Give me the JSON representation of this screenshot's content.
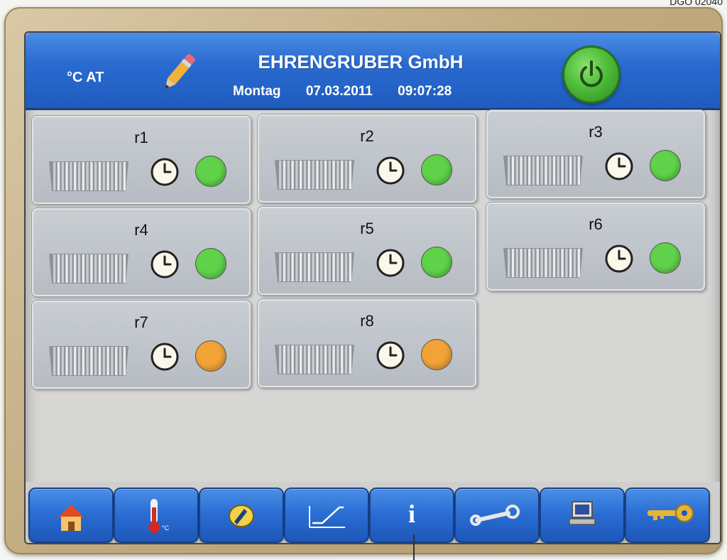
{
  "corner_label": "DGO 02040",
  "header": {
    "unit_label": "°C AT",
    "title": "EHRENGRUBER GmbH",
    "day": "Montag",
    "date": "07.03.2011",
    "time": "09:07:28"
  },
  "rooms": [
    {
      "name": "r1",
      "status": "green"
    },
    {
      "name": "r2",
      "status": "green"
    },
    {
      "name": "r3",
      "status": "green"
    },
    {
      "name": "r4",
      "status": "green"
    },
    {
      "name": "r5",
      "status": "green"
    },
    {
      "name": "r6",
      "status": "green"
    },
    {
      "name": "r7",
      "status": "orange"
    },
    {
      "name": "r8",
      "status": "orange"
    }
  ],
  "colors": {
    "status_green": "#5fd24a",
    "status_orange": "#f2a336",
    "header_blue": "#2a6bd1"
  },
  "toolbar": {
    "buttons": [
      {
        "icon": "home-icon"
      },
      {
        "icon": "thermometer-icon"
      },
      {
        "icon": "gauge-icon"
      },
      {
        "icon": "curve-icon"
      },
      {
        "icon": "info-icon",
        "label": "i"
      },
      {
        "icon": "wrench-icon"
      },
      {
        "icon": "computer-icon"
      },
      {
        "icon": "key-icon"
      }
    ]
  }
}
